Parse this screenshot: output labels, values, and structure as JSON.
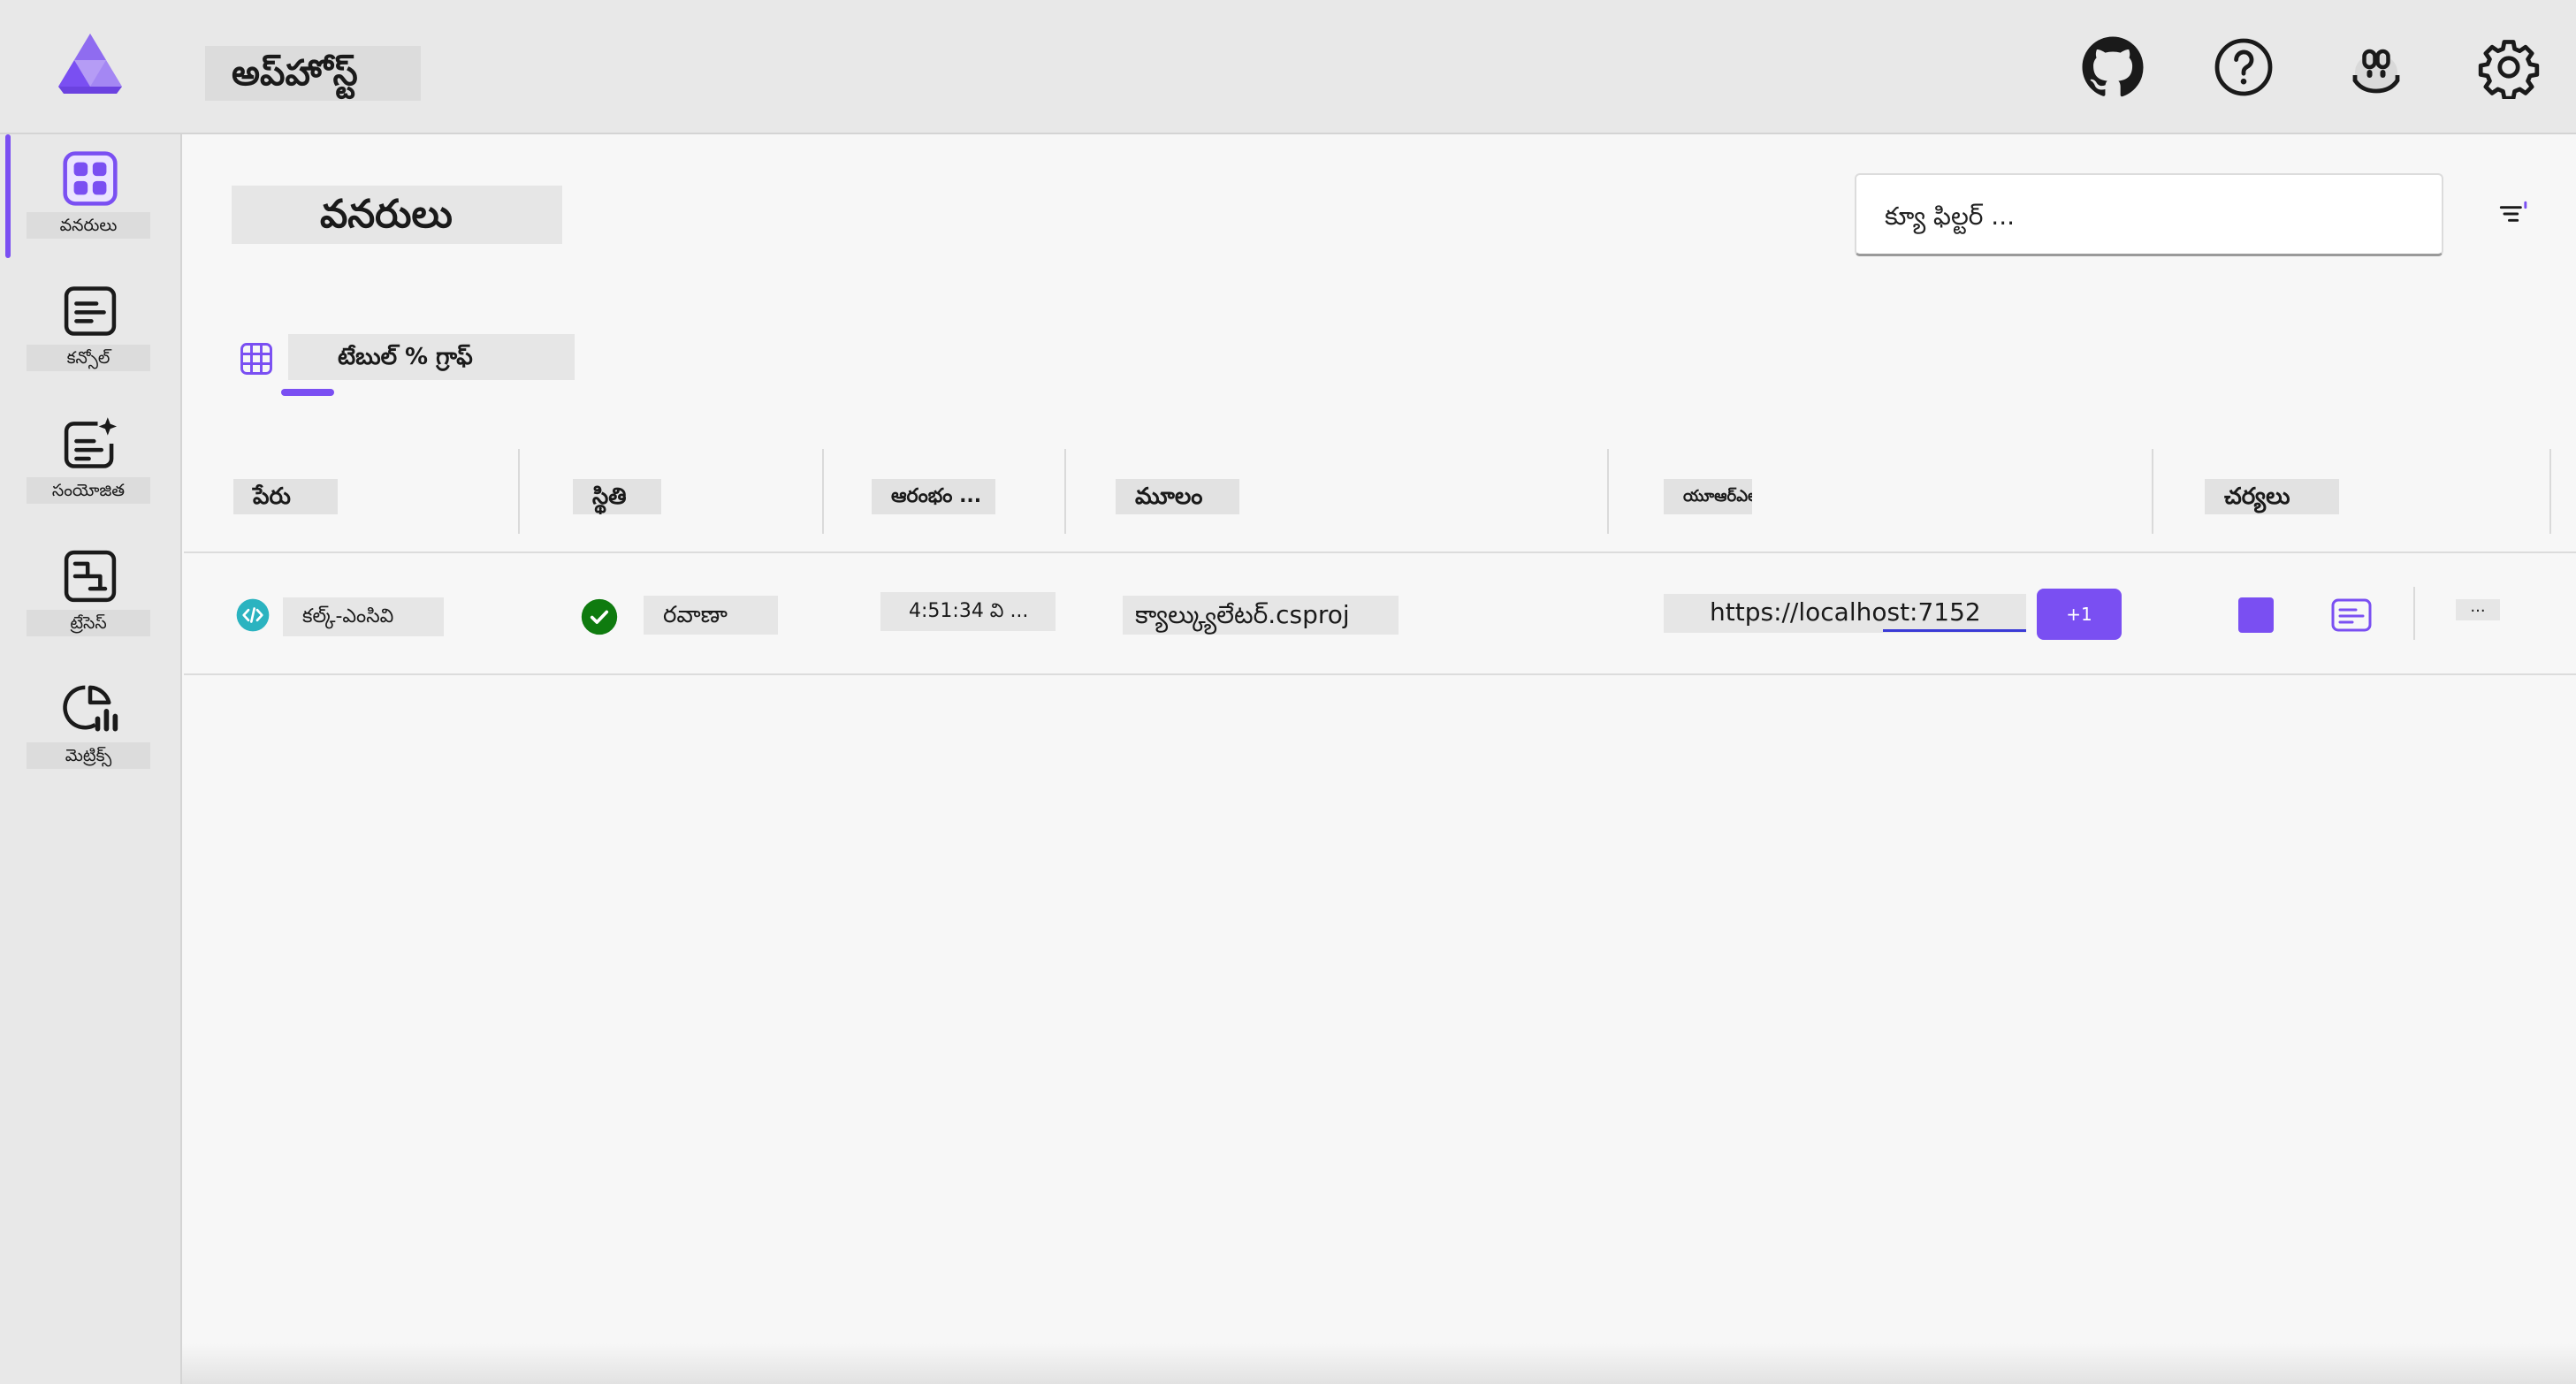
{
  "header": {
    "app_title": "అప్‌హోస్ట్",
    "icons": [
      "github-icon",
      "help-icon",
      "copilot-icon",
      "settings-icon"
    ]
  },
  "sidebar": {
    "items": [
      {
        "label": "వనరులు",
        "icon": "resources-icon",
        "active": true
      },
      {
        "label": "కన్సోల్",
        "icon": "console-icon",
        "active": false
      },
      {
        "label": "సంయోజిత",
        "icon": "structured-logs-icon",
        "active": false
      },
      {
        "label": "ట్రేసెస్",
        "icon": "traces-icon",
        "active": false
      },
      {
        "label": "మెట్రిక్స్",
        "icon": "metrics-icon",
        "active": false
      }
    ]
  },
  "main": {
    "title": "వనరులు",
    "filter_placeholder": "క్యూ ఫిల్టర్ ...",
    "view_tab_label": "టేబుల్ % గ్రాఫ్"
  },
  "table": {
    "columns": [
      "పేరు",
      "స్థితి",
      "ఆరంభం ...",
      "మూలం",
      "యూఆర్ఎల్స్",
      "చర్యలు"
    ],
    "rows": [
      {
        "name": "కల్క్-ఎంసివి",
        "state": "రవాణా",
        "start": "4:51:34 వి ...",
        "source": "క్యాల్క్యులేటర్.csproj",
        "url": "https://localhost:7152",
        "more_urls": "+1",
        "more": "..."
      }
    ]
  },
  "colors": {
    "accent": "#7a4ff2",
    "running": "#0f7b0f",
    "project": "#2bb3c0"
  }
}
